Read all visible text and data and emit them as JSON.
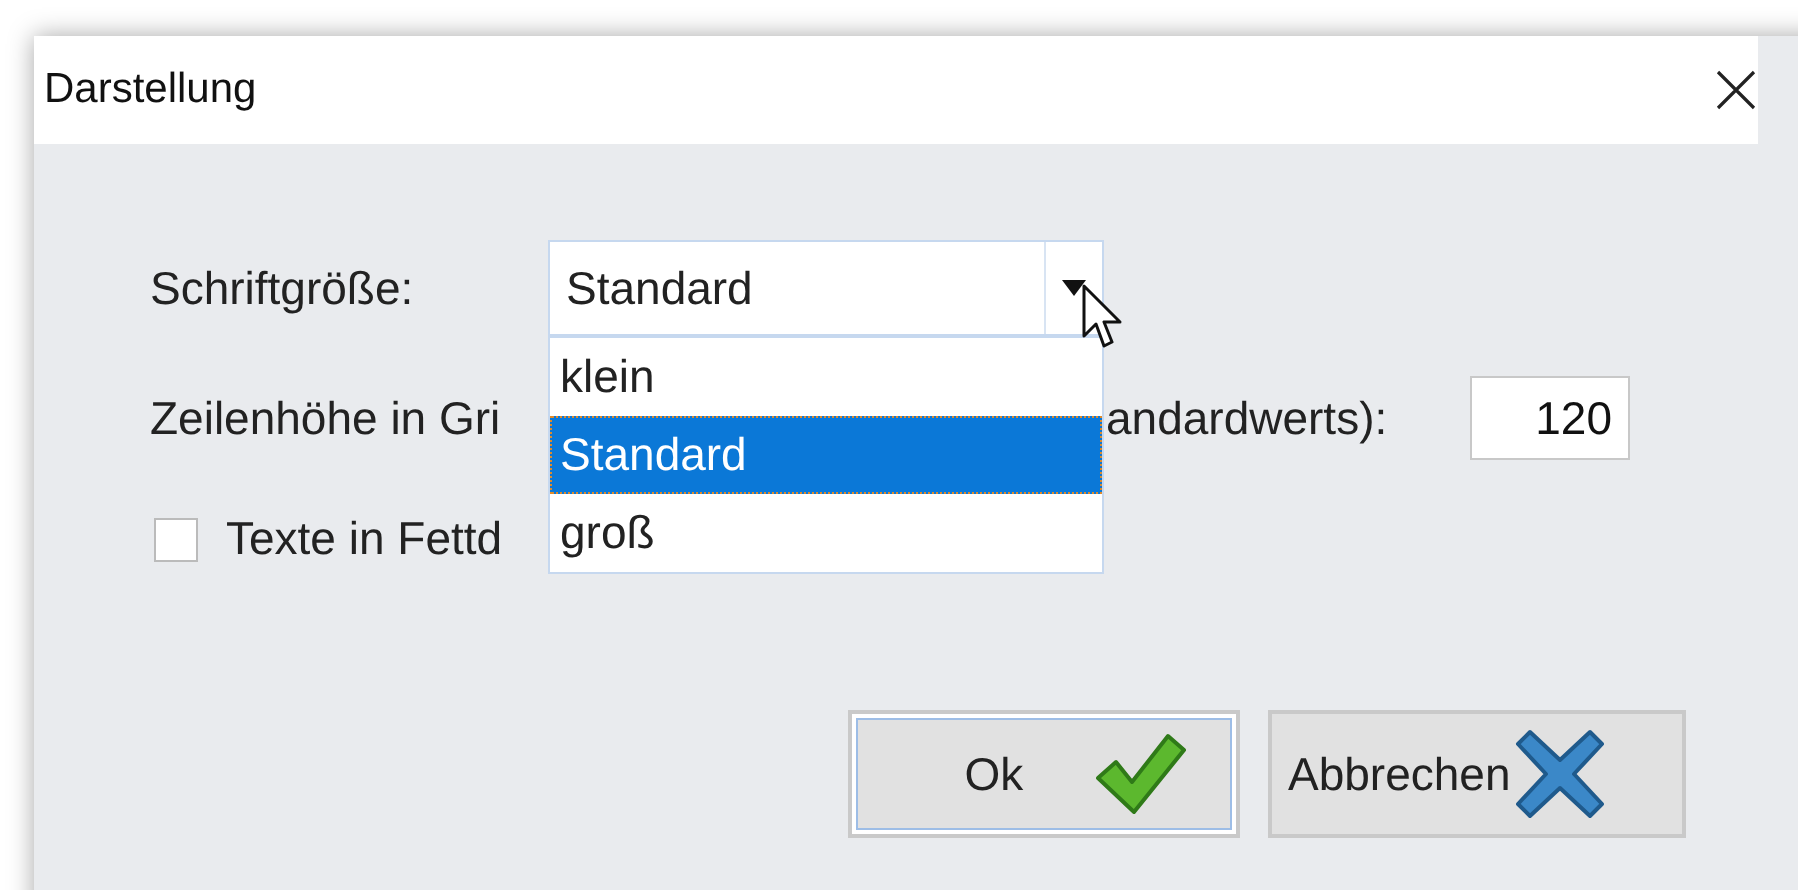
{
  "window": {
    "title": "Darstellung"
  },
  "font_size": {
    "label": "Schriftgröße:",
    "value": "Standard",
    "expanded": true,
    "options": [
      {
        "label": "klein",
        "selected": false
      },
      {
        "label": "Standard",
        "selected": true
      },
      {
        "label": "groß",
        "selected": false
      }
    ]
  },
  "line_height": {
    "label_parts": [
      "Zeilenhöhe in Gri",
      "andardwerts):"
    ],
    "value": "120"
  },
  "bold_texts": {
    "label": "Texte in Fettd",
    "checked": false
  },
  "buttons": [
    {
      "label": "Ok",
      "kind": "ok",
      "default": true
    },
    {
      "label": "Abbrechen",
      "kind": "cancel",
      "default": false
    }
  ]
}
